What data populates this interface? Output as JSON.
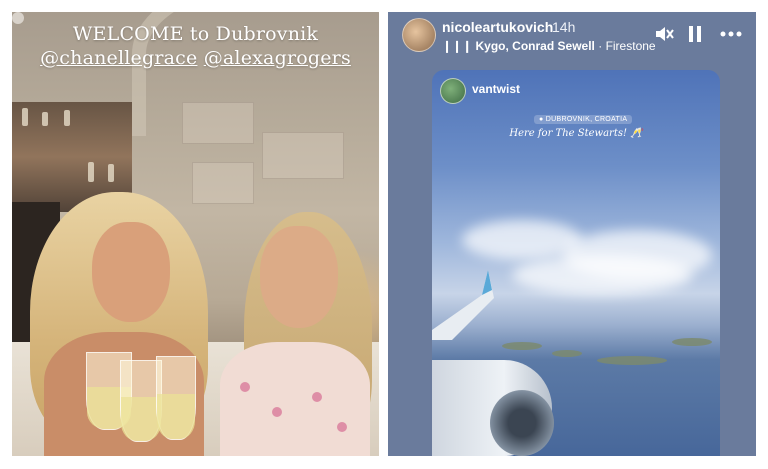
{
  "left_story": {
    "title_line": "WELCOME to Dubrovnik",
    "tag_1": "@chanellegrace",
    "tag_2": "@alexagrogers"
  },
  "right_story": {
    "username": "nicoleartukovich",
    "time": "14h",
    "music_artists": "Kygo, Conrad Sewell",
    "music_separator": "·",
    "music_track": "Firestone",
    "controls": {
      "mute_icon": "speaker-muted-icon",
      "pause_icon": "pause-icon",
      "more_icon": "more-dots-icon",
      "music_icon": "music-bars-icon"
    },
    "shared_post": {
      "username": "vantwist",
      "location_sticker": "DUBROVNIK, CROATIA",
      "caption": "Here for The Stewarts! 🥂"
    }
  },
  "colors": {
    "story_bg_right": "#6a7b9c",
    "text_white": "#ffffff"
  }
}
